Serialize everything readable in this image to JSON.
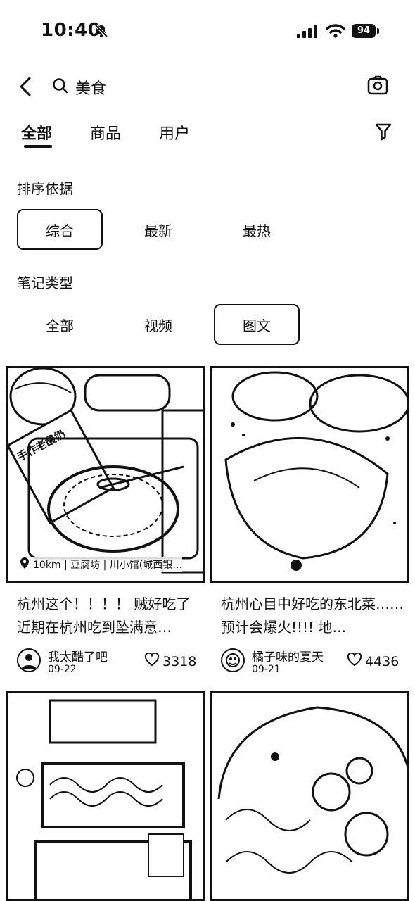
{
  "status_bar": {
    "time": "10:40",
    "battery": "94"
  },
  "search": {
    "query": "美食"
  },
  "tabs": [
    {
      "label": "全部",
      "active": true
    },
    {
      "label": "商品",
      "active": false
    },
    {
      "label": "用户",
      "active": false
    }
  ],
  "sort": {
    "label": "排序依据",
    "options": [
      "综合",
      "最新",
      "最热"
    ],
    "selected": "综合"
  },
  "note_type": {
    "label": "笔记类型",
    "options": [
      "全部",
      "视频",
      "图文"
    ],
    "selected": "图文"
  },
  "cards": [
    {
      "title": "杭州这个！！！！ 贼好吃了 近期在杭州吃到坠满意…",
      "location": "10km | 豆腐坊 | 川小馆(城西银…",
      "badge_text": "手作老酸奶",
      "author": "我太酷了吧",
      "date": "09-22",
      "likes": "3318"
    },
    {
      "title": "杭州心目中好吃的东北菜……预计会爆火!!!! 地…",
      "author": "橘子味的夏天",
      "date": "09-21",
      "likes": "4436"
    },
    {
      "title": "",
      "author": "",
      "date": "",
      "likes": ""
    },
    {
      "title": "",
      "author": "",
      "date": "",
      "likes": ""
    }
  ]
}
